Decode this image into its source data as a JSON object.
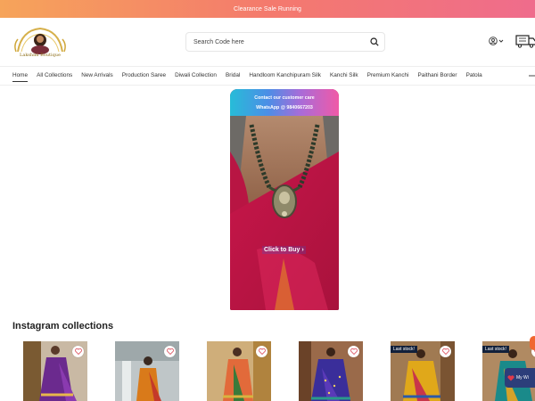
{
  "announcement": {
    "text": "Clearance Sale Running"
  },
  "brand": {
    "name": "Lakshmi Boutique"
  },
  "search": {
    "placeholder": "Search Code here"
  },
  "nav": {
    "items": [
      {
        "label": "Home"
      },
      {
        "label": "All Collections"
      },
      {
        "label": "New Arrivals"
      },
      {
        "label": "Production Saree"
      },
      {
        "label": "Diwali Collection"
      },
      {
        "label": "Bridal"
      },
      {
        "label": "Handloom Kanchipuram Silk"
      },
      {
        "label": "Kanchi Silk"
      },
      {
        "label": "Premium Kanchi"
      },
      {
        "label": "Paithani Border"
      },
      {
        "label": "Patola"
      }
    ]
  },
  "video": {
    "banner_line1": "Contact our customer care",
    "banner_line2": "WhatsApp @ 9840667203",
    "buy_label": "Click to Buy ›"
  },
  "instagram": {
    "title": "Instagram collections",
    "cards": [
      {
        "badge": ""
      },
      {
        "badge": ""
      },
      {
        "badge": ""
      },
      {
        "badge": ""
      },
      {
        "badge": "Last stock!"
      },
      {
        "badge": "Last stock!"
      }
    ]
  },
  "wishlist": {
    "label": "My Wi"
  },
  "colors": {
    "accent": "#f47a6d",
    "banner_start": "#f6a45a",
    "banner_end": "#ef6c8c",
    "saree": "#b81543"
  },
  "icons": [
    "search-icon",
    "user-icon",
    "chevron-down-icon",
    "cart-icon",
    "heart-icon",
    "chevron-right-icon"
  ]
}
